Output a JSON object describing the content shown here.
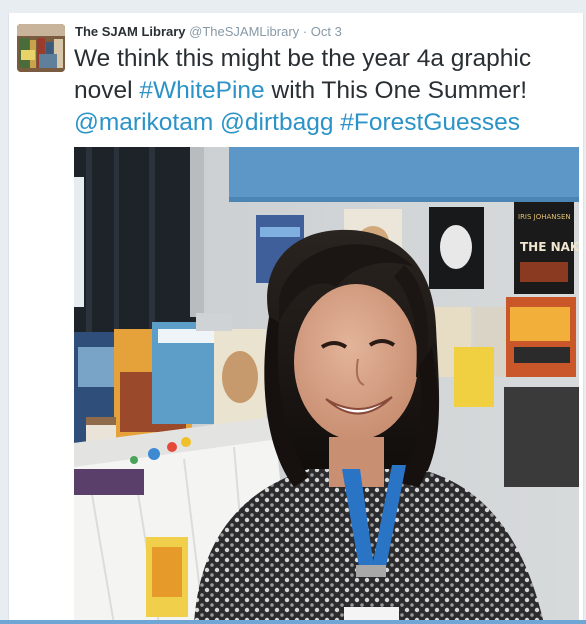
{
  "tweet": {
    "display_name": "The SJAM Library",
    "screen_name": "@TheSJAMLibrary",
    "separator": "·",
    "timestamp": "Oct 3",
    "text_1": "We think this might be the year 4a graphic novel ",
    "hashtag_1": "#WhitePine",
    "text_2": " with This One Summer! ",
    "mention_1": "@marikotam",
    "mention_2": "@dirtbagg",
    "hashtag_2": "#ForestGuesses"
  },
  "photo": {
    "book_titles": [
      "THE NAKED EYE"
    ]
  },
  "colors": {
    "link": "#2b93c7",
    "name": "#292f33",
    "meta": "#8899a6",
    "lanyard": "#2a74c6"
  }
}
